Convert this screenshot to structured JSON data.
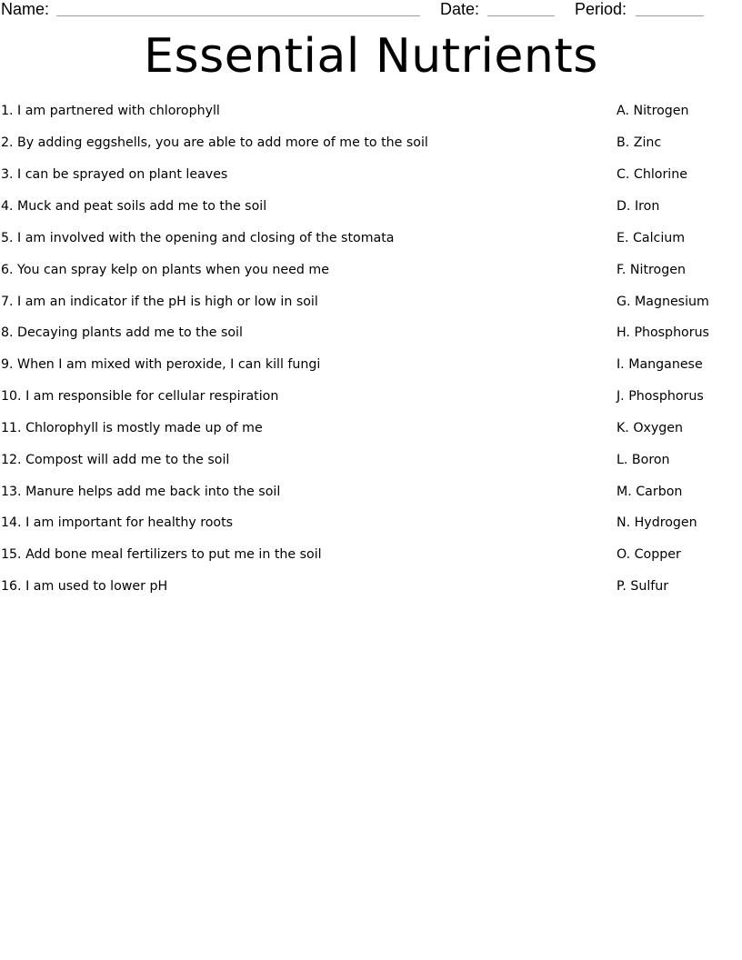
{
  "header": {
    "name_label": "Name:",
    "date_label": "Date:",
    "period_label": "Period:"
  },
  "title": "Essential Nutrients",
  "clues": [
    "1. I am partnered with chlorophyll",
    "2. By adding eggshells, you are able to add more of me to the soil",
    "3. I can be sprayed on plant leaves",
    "4. Muck and peat soils add me to the soil",
    "5. I am involved with the opening and closing of the stomata",
    "6. You can spray kelp on plants when you need me",
    "7. I am an indicator if the pH is high or low in soil",
    "8. Decaying plants add me to the soil",
    "9. When I am mixed with peroxide, I can kill fungi",
    "10. I am responsible for cellular respiration",
    "11. Chlorophyll is mostly made up of me",
    "12. Compost will add me to the soil",
    "13. Manure helps add me back into the soil",
    "14. I am important for healthy roots",
    "15. Add bone meal fertilizers to put me in the soil",
    "16. I am used to lower pH"
  ],
  "answers": [
    "A. Nitrogen",
    "B. Zinc",
    "C. Chlorine",
    "D. Iron",
    "E. Calcium",
    "F. Nitrogen",
    "G. Magnesium",
    "H. Phosphorus",
    "I. Manganese",
    "J. Phosphorus",
    "K. Oxygen",
    "L. Boron",
    "M. Carbon",
    "N. Hydrogen",
    "O. Copper",
    "P. Sulfur"
  ]
}
